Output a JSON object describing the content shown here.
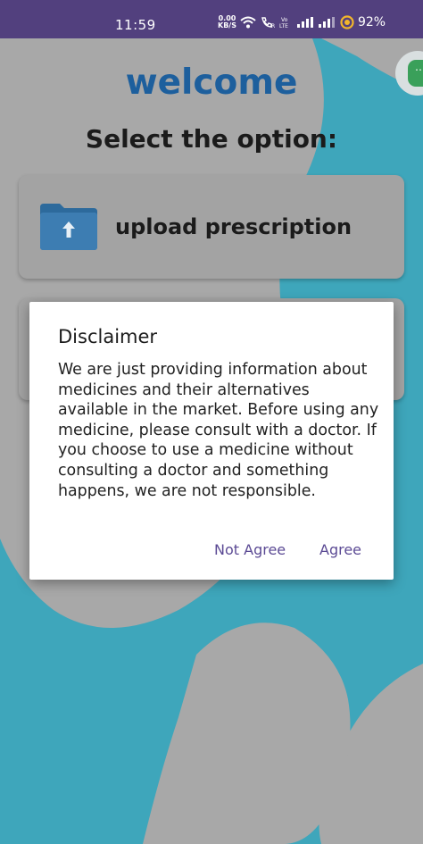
{
  "status_bar": {
    "time": "11:59",
    "data_speed_value": "0.00",
    "data_speed_unit": "KB/S",
    "battery": "92%"
  },
  "main": {
    "title": "welcome",
    "subtitle": "Select the option:",
    "options": [
      {
        "label": "upload prescription",
        "icon": "folder-upload-icon"
      }
    ]
  },
  "dialog": {
    "title": "Disclaimer",
    "body": "We are just providing information about medicines and their alternatives available in the market. Before using any medicine, please consult with a doctor. If you choose to use a medicine without consulting a doctor and something happens, we are not responsible.",
    "not_agree_label": "Not Agree",
    "agree_label": "Agree"
  },
  "colors": {
    "status_bar": "#52407e",
    "title": "#1d5f9d",
    "card": "#a3a3a3",
    "background_teal": "#3ea6bb",
    "background_gray": "#a8a8a8",
    "dialog_button": "#5b4a94"
  }
}
